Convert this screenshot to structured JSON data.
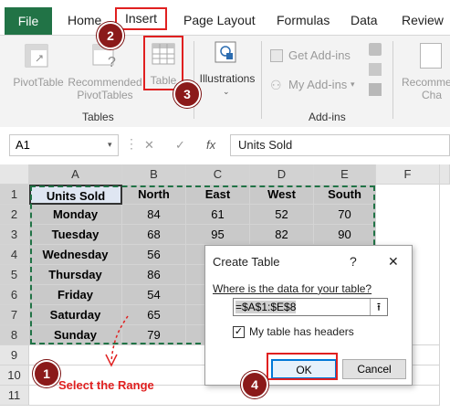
{
  "tabs": {
    "file": "File",
    "home": "Home",
    "insert": "Insert",
    "page_layout": "Page Layout",
    "formulas": "Formulas",
    "data": "Data",
    "review": "Review"
  },
  "ribbon": {
    "pivottable": "PivotTable",
    "recommended_line1": "Recommended",
    "recommended_line2": "PivotTables",
    "table": "Table",
    "illustrations": "Illustrations",
    "get_addins": "Get Add-ins",
    "my_addins": "My Add-ins",
    "recommended_charts_line1": "Recomme",
    "recommended_charts_line2": "Cha",
    "group_tables": "Tables",
    "group_addins": "Add-ins"
  },
  "formula_bar": {
    "name_box": "A1",
    "fx": "fx",
    "formula": "Units Sold"
  },
  "columns": [
    "A",
    "B",
    "C",
    "D",
    "E",
    "F"
  ],
  "row_numbers": [
    "1",
    "2",
    "3",
    "4",
    "5",
    "6",
    "7",
    "8",
    "9",
    "10",
    "11"
  ],
  "table": {
    "headers": [
      "Units Sold",
      "North",
      "East",
      "West",
      "South"
    ],
    "rows": [
      [
        "Monday",
        "84",
        "61",
        "52",
        "70"
      ],
      [
        "Tuesday",
        "68",
        "95",
        "82",
        "90"
      ],
      [
        "Wednesday",
        "56",
        "",
        "",
        ""
      ],
      [
        "Thursday",
        "86",
        "",
        "",
        ""
      ],
      [
        "Friday",
        "54",
        "",
        "",
        ""
      ],
      [
        "Saturday",
        "65",
        "",
        "",
        ""
      ],
      [
        "Sunday",
        "79",
        "",
        "",
        ""
      ]
    ]
  },
  "dialog": {
    "title": "Create Table",
    "help": "?",
    "close": "✕",
    "prompt": "Where is the data for your table?",
    "range": "=$A$1:$E$8",
    "checkbox_label": "My table has headers",
    "checkbox_checked": true,
    "ok": "OK",
    "cancel": "Cancel"
  },
  "annotations": {
    "step1": "1",
    "step2": "2",
    "step3": "3",
    "step4": "4",
    "select_range": "Select the Range"
  },
  "colors": {
    "excel_green": "#217346",
    "annotation_red": "#e02020",
    "badge_red": "#8b1a1a",
    "table_fill": "#c9c9c9",
    "header_fill": "#dfe6f2"
  }
}
